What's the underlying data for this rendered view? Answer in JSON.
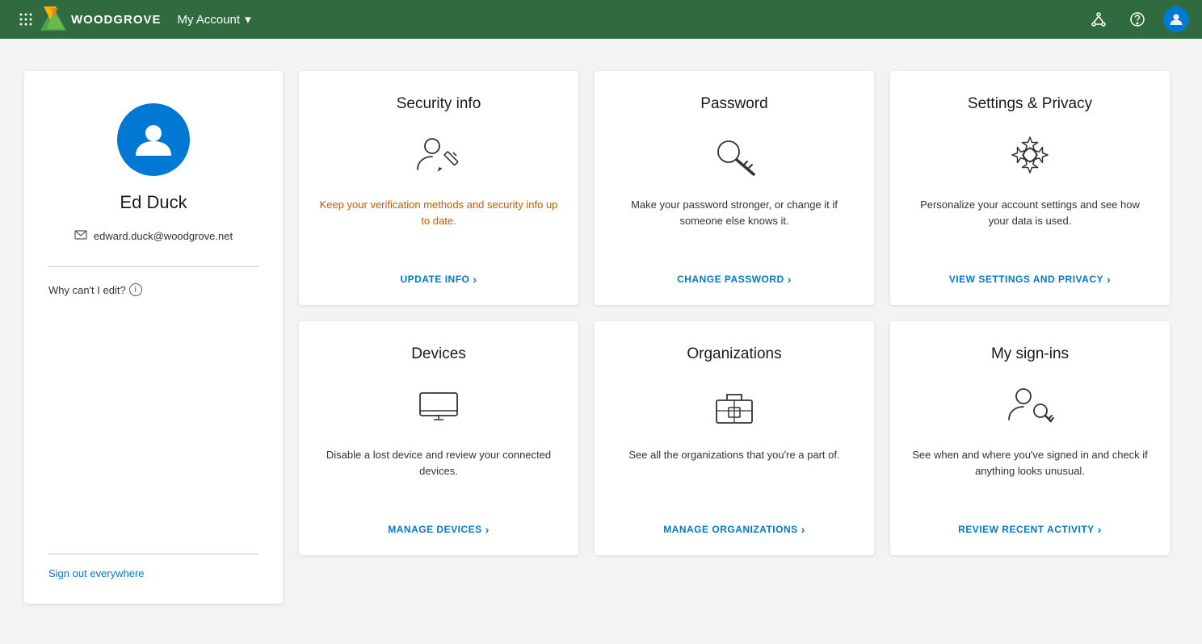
{
  "header": {
    "logo_text": "WOODGROVE",
    "account_menu_label": "My Account",
    "chevron": "▾"
  },
  "user": {
    "name": "Ed Duck",
    "email": "edward.duck@woodgrove.net",
    "why_edit_label": "Why can't I edit?",
    "sign_out_label": "Sign out everywhere"
  },
  "tiles": [
    {
      "id": "security-info",
      "title": "Security info",
      "description": "Keep your verification methods and security info up to date.",
      "desc_class": "orange",
      "link_label": "UPDATE INFO",
      "link_chevron": "›"
    },
    {
      "id": "password",
      "title": "Password",
      "description": "Make your password stronger, or change it if someone else knows it.",
      "desc_class": "",
      "link_label": "CHANGE PASSWORD",
      "link_chevron": "›"
    },
    {
      "id": "settings-privacy",
      "title": "Settings & Privacy",
      "description": "Personalize your account settings and see how your data is used.",
      "desc_class": "",
      "link_label": "VIEW SETTINGS AND PRIVACY",
      "link_chevron": "›"
    },
    {
      "id": "devices",
      "title": "Devices",
      "description": "Disable a lost device and review your connected devices.",
      "desc_class": "",
      "link_label": "MANAGE DEVICES",
      "link_chevron": "›"
    },
    {
      "id": "organizations",
      "title": "Organizations",
      "description": "See all the organizations that you're a part of.",
      "desc_class": "",
      "link_label": "MANAGE ORGANIZATIONS",
      "link_chevron": "›"
    },
    {
      "id": "my-sign-ins",
      "title": "My sign-ins",
      "description": "See when and where you've signed in and check if anything looks unusual.",
      "desc_class": "",
      "link_label": "REVIEW RECENT ACTIVITY",
      "link_chevron": "›"
    }
  ]
}
